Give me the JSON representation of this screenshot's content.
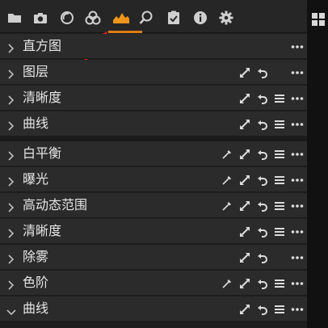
{
  "toolbar": {
    "icons": [
      "folder-icon",
      "camera-icon",
      "lens-icon",
      "color-circles-icon",
      "exposure-icon",
      "search-icon",
      "clipboard-check-icon",
      "info-icon",
      "gear-icon"
    ],
    "active_color": "#f0951b"
  },
  "panels": [
    {
      "title": "直方图",
      "expanded": false,
      "actions": [
        "more"
      ]
    },
    {
      "title": "图层",
      "expanded": false,
      "actions": [
        "expand",
        "reset",
        "more"
      ]
    },
    {
      "title": "清晰度",
      "expanded": false,
      "actions": [
        "expand",
        "reset",
        "list",
        "more"
      ]
    },
    {
      "title": "曲线",
      "expanded": false,
      "actions": [
        "expand",
        "reset",
        "list",
        "more"
      ]
    },
    {
      "title": "白平衡",
      "expanded": false,
      "actions": [
        "picker",
        "expand",
        "reset",
        "list",
        "more"
      ]
    },
    {
      "title": "曝光",
      "expanded": false,
      "actions": [
        "picker",
        "expand",
        "reset",
        "list",
        "more"
      ]
    },
    {
      "title": "高动态范围",
      "expanded": false,
      "actions": [
        "picker",
        "expand",
        "reset",
        "list",
        "more"
      ]
    },
    {
      "title": "清晰度",
      "expanded": false,
      "actions": [
        "expand",
        "reset",
        "list",
        "more"
      ]
    },
    {
      "title": "除雾",
      "expanded": false,
      "actions": [
        "expand",
        "reset",
        "more"
      ]
    },
    {
      "title": "色阶",
      "expanded": false,
      "actions": [
        "picker",
        "expand",
        "reset",
        "list",
        "more"
      ]
    },
    {
      "title": "曲线",
      "expanded": true,
      "actions": [
        "expand",
        "reset",
        "list",
        "more"
      ]
    }
  ]
}
